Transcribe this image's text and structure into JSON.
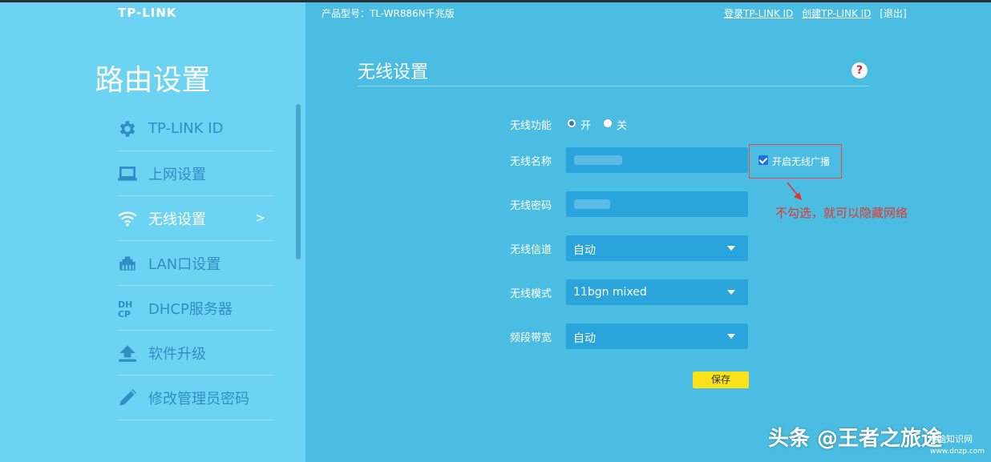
{
  "header": {
    "logo": "TP-LINK",
    "model": "产品型号：TL-WR886N千兆版",
    "links": [
      "登录TP-LINK ID",
      "创建TP-LINK ID",
      "[退出]"
    ]
  },
  "sidebar": {
    "title": "路由设置",
    "items": [
      {
        "label": "TP-LINK ID",
        "icon": "gear-icon"
      },
      {
        "label": "上网设置",
        "icon": "laptop-icon"
      },
      {
        "label": "无线设置",
        "icon": "wifi-icon",
        "active": true,
        "arrow": ">"
      },
      {
        "label": "LAN口设置",
        "icon": "lan-port-icon"
      },
      {
        "label": "DHCP服务器",
        "icon": "dhcp-icon"
      },
      {
        "label": "软件升级",
        "icon": "upload-icon"
      },
      {
        "label": "修改管理员密码",
        "icon": "pencil-icon"
      }
    ]
  },
  "main": {
    "title": "无线设置",
    "help": "?",
    "wireless_function": {
      "label": "无线功能",
      "on": "开",
      "off": "关",
      "selected": "开"
    },
    "ssid": {
      "label": "无线名称",
      "broadcast_label": "开启无线广播",
      "broadcast_checked": true
    },
    "password": {
      "label": "无线密码"
    },
    "channel": {
      "label": "无线信道",
      "value": "自动"
    },
    "mode": {
      "label": "无线模式",
      "value": "11bgn mixed"
    },
    "bandwidth": {
      "label": "频段带宽",
      "value": "自动"
    },
    "save_label": "保存",
    "annotation": "不勾选，就可以隐藏网络"
  },
  "colors": {
    "accent": "#2aa5db",
    "sidebar": "#6dd3f2",
    "main": "#4bbde2",
    "save": "#f9e21a",
    "annotation": "#e5342b"
  },
  "watermark": {
    "text": "头条 @王者之旅途",
    "small": "电脑知识网",
    "url": "www.dnzp.com"
  }
}
